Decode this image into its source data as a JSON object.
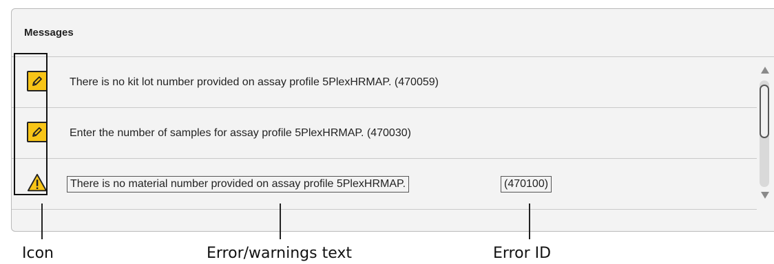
{
  "panel": {
    "title": "Messages"
  },
  "messages": [
    {
      "icon": "pencil-icon",
      "text": "There is no kit lot number provided on assay profile 5PlexHRMAP. (470059)"
    },
    {
      "icon": "pencil-icon",
      "text": "Enter the number of samples for assay profile 5PlexHRMAP. (470030)"
    },
    {
      "icon": "warning-icon",
      "text": "There is no material number provided on assay profile 5PlexHRMAP.",
      "error_id": "(470100)"
    }
  ],
  "callouts": {
    "icon": "Icon",
    "text": "Error/warnings text",
    "error_id": "Error ID"
  },
  "colors": {
    "icon_fill": "#f8c517",
    "panel_bg": "#f3f3f3"
  }
}
